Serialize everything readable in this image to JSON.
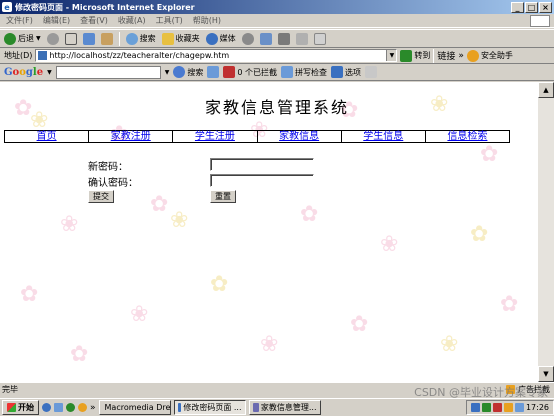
{
  "window": {
    "title": "修改密码页面 - Microsoft Internet Explorer",
    "controls": [
      "_",
      "□",
      "×"
    ]
  },
  "menu": [
    "文件(F)",
    "编辑(E)",
    "查看(V)",
    "收藏(A)",
    "工具(T)",
    "帮助(H)"
  ],
  "toolbar": {
    "back": "后退",
    "search": "搜索",
    "favorites": "收藏夹",
    "media": "媒体"
  },
  "address": {
    "label": "地址(D)",
    "url": "http://localhost/zz/teacheralter/chagepw.htm",
    "go": "转到",
    "links": "链接",
    "safety": "安全助手"
  },
  "googlebar": {
    "logo": "Google",
    "search": "搜索",
    "blocked": "0 个已拦截",
    "spellcheck": "拼写检查",
    "options": "选项"
  },
  "page": {
    "title": "家教信息管理系统",
    "nav": [
      "首页",
      "家教注册",
      "学生注册",
      "家教信息",
      "学生信息",
      "信息检索"
    ],
    "form": {
      "new_password_label": "新密码：",
      "confirm_password_label": "确认密码：",
      "submit": "提交",
      "reset": "重置"
    }
  },
  "status": {
    "text": "完毕",
    "ad_block": "广告拦截",
    "watermark": "CSDN @毕业设计方案专家"
  },
  "taskbar": {
    "start": "开始",
    "tasks": [
      {
        "label": "Macromedia Dre...",
        "active": false
      },
      {
        "label": "修改密码页面 ...",
        "active": true
      },
      {
        "label": "家教信息管理...",
        "active": false
      }
    ],
    "clock": "17:26"
  }
}
